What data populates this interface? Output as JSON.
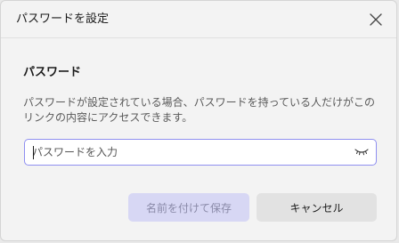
{
  "dialog": {
    "title": "パスワードを設定",
    "close_icon": "close-icon"
  },
  "password_section": {
    "heading": "パスワード",
    "description": "パスワードが設定されている場合、パスワードを持っている人だけがこのリンクの内容にアクセスできます。",
    "input": {
      "placeholder": "パスワードを入力",
      "value": "",
      "reveal_icon": "eye-closed-icon"
    }
  },
  "buttons": {
    "save_label": "名前を付けて保存",
    "save_enabled": false,
    "cancel_label": "キャンセル"
  },
  "colors": {
    "accent_border": "#8f8ff0",
    "primary_disabled_bg": "#d7d7f4"
  }
}
